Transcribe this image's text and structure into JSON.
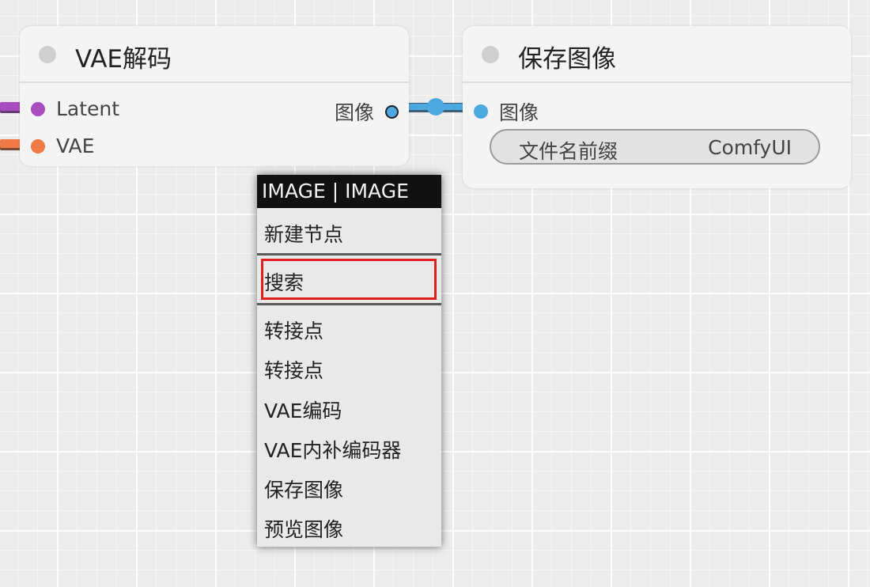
{
  "colors": {
    "latent": "#a84cc0",
    "vae": "#f07a45",
    "image": "#4ea8e0",
    "highlight": "#e01e1e"
  },
  "nodes": {
    "vae_decode": {
      "title": "VAE解码",
      "inputs": [
        "Latent",
        "VAE"
      ],
      "output": "图像"
    },
    "save_image": {
      "title": "保存图像",
      "input": "图像",
      "widget": {
        "label": "文件名前缀",
        "value": "ComfyUI"
      }
    }
  },
  "context_menu": {
    "title": "IMAGE | IMAGE",
    "items": [
      "新建节点",
      "搜索",
      "转接点",
      "转接点",
      "VAE编码",
      "VAE内补编码器",
      "保存图像",
      "预览图像"
    ],
    "highlighted_item": "搜索"
  }
}
